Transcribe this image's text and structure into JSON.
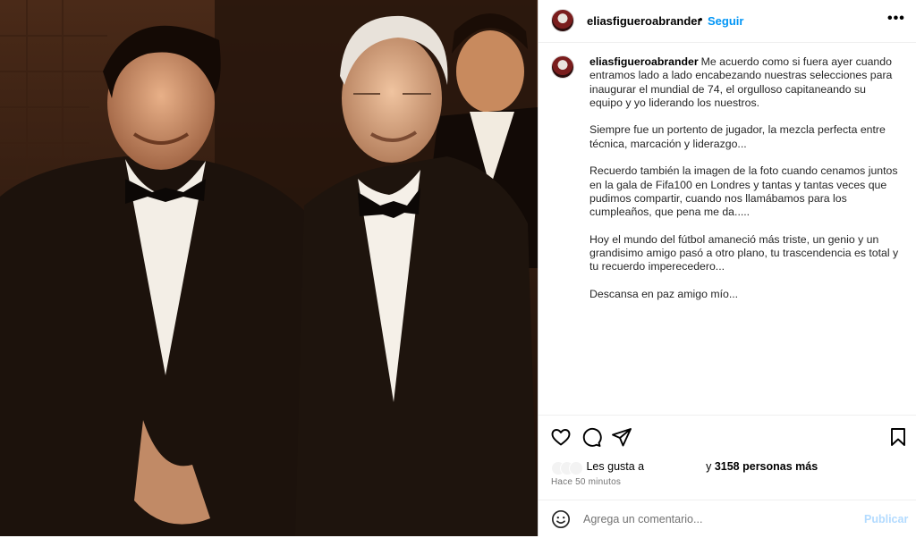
{
  "post": {
    "username": "eliasfigueroabrander",
    "separator": "•",
    "follow_label": "Seguir",
    "more_icon": "more-horizontal-icon",
    "caption_paragraphs": [
      "Me acuerdo como si fuera ayer cuando entramos lado a lado encabezando nuestras selecciones para inaugurar el mundial de 74, el orgulloso capitaneando su equipo y yo liderando los nuestros.",
      "Siempre fue un portento de jugador, la mezcla perfecta entre técnica, marcación y liderazgo...",
      "Recuerdo también la imagen de la foto cuando cenamos juntos en la gala de Fifa100 en Londres y tantas y tantas veces que pudimos compartir, cuando nos llamábamos para los cumpleaños, que pena me da.....",
      "Hoy el mundo del fútbol amaneció más triste, un genio y un grandisimo amigo pasó a otro plano, tu trascendencia es total y tu recuerdo imperecedero...",
      "Descansa en paz amigo mío..."
    ],
    "likes_prefix": "Les gusta a",
    "likes_conj": "y",
    "likes_count": "3158 personas más",
    "timestamp": "Hace 50 minutos",
    "comment_placeholder": "Agrega un comentario...",
    "publish_label": "Publicar"
  },
  "colors": {
    "accent": "#0095f6",
    "publish_disabled": "#b3dbff",
    "photo_bg": "#1a0f08"
  }
}
